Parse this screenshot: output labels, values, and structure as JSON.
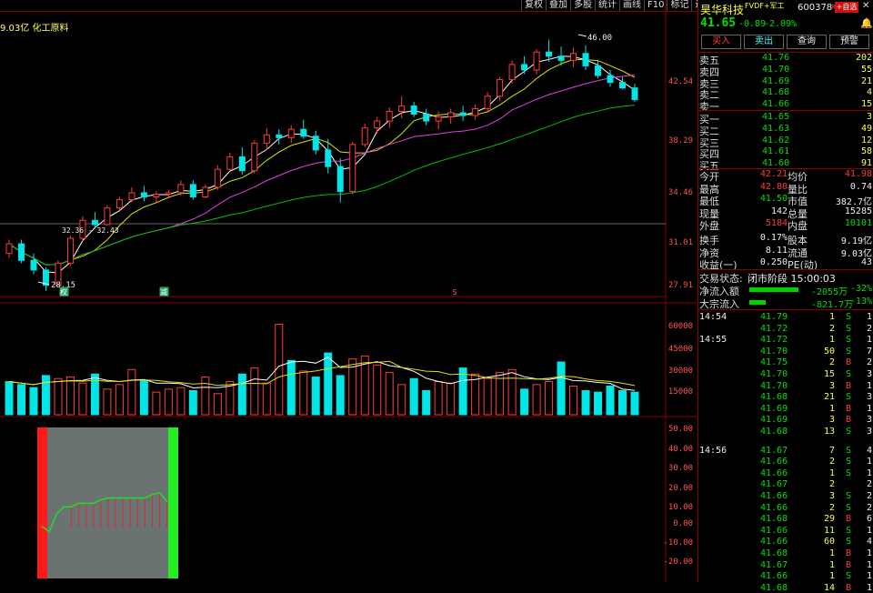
{
  "toolbar": [
    "复权",
    "叠加",
    "多股",
    "统计",
    "画线",
    "F10",
    "标记",
    "返回"
  ],
  "main_info": {
    "value": "9.03亿",
    "sector": "化工原料"
  },
  "price_axis": [
    "42.54",
    "38.29",
    "34.46",
    "31.01",
    "27.91"
  ],
  "price_marks": {
    "high": "46.00",
    "low": "28.15",
    "range": "32.36 - 32.43"
  },
  "event_labels": [
    "权",
    "减",
    "S"
  ],
  "volume_axis": [
    "60000",
    "45000",
    "30000",
    "15000"
  ],
  "indicator_axis": [
    "50.00",
    "40.00",
    "30.00",
    "20.00",
    "10.00",
    "0.00",
    "-10.00",
    "-20.00"
  ],
  "stock": {
    "name": "昊华科技",
    "tags": "FVDF+军工",
    "code": "600378",
    "flag": "R",
    "price": "41.65",
    "change": "-0.89",
    "pct": "-2.09%",
    "add_btn": "+自选"
  },
  "actions": [
    "买入",
    "卖出",
    "查询",
    "预警"
  ],
  "order_book": {
    "asks": [
      {
        "label": "卖五",
        "price": "41.76",
        "vol": "202"
      },
      {
        "label": "卖四",
        "price": "41.70",
        "vol": "55"
      },
      {
        "label": "卖三",
        "price": "41.69",
        "vol": "21"
      },
      {
        "label": "卖二",
        "price": "41.68",
        "vol": "4"
      },
      {
        "label": "卖一",
        "price": "41.66",
        "vol": "15"
      }
    ],
    "bids": [
      {
        "label": "买一",
        "price": "41.65",
        "vol": "3"
      },
      {
        "label": "买二",
        "price": "41.63",
        "vol": "49"
      },
      {
        "label": "买三",
        "price": "41.62",
        "vol": "12"
      },
      {
        "label": "买四",
        "price": "41.61",
        "vol": "58"
      },
      {
        "label": "买五",
        "price": "41.60",
        "vol": "91"
      }
    ]
  },
  "stats": [
    {
      "l1": "今开",
      "v1": "42.21",
      "c1": "red",
      "l2": "均价",
      "v2": "41.98",
      "c2": "red"
    },
    {
      "l1": "最高",
      "v1": "42.80",
      "c1": "red",
      "l2": "量比",
      "v2": "0.74",
      "c2": "white"
    },
    {
      "l1": "最低",
      "v1": "41.50",
      "c1": "green",
      "l2": "市值",
      "v2": "382.7亿",
      "c2": "white"
    },
    {
      "l1": "现量",
      "v1": "142",
      "c1": "white",
      "l2": "总量",
      "v2": "15285",
      "c2": "white"
    },
    {
      "l1": "外盘",
      "v1": "5184",
      "c1": "red",
      "l2": "内盘",
      "v2": "10101",
      "c2": "green"
    },
    {
      "l1": "换手",
      "v1": "0.17%",
      "c1": "white",
      "l2": "股本",
      "v2": "9.19亿",
      "c2": "white"
    },
    {
      "l1": "净资",
      "v1": "8.11",
      "c1": "white",
      "l2": "流通",
      "v2": "9.03亿",
      "c2": "white"
    },
    {
      "l1": "收益(一)",
      "v1": "0.250",
      "c1": "white",
      "l2": "PE(动)",
      "v2": "43",
      "c2": "white"
    }
  ],
  "status": {
    "label": "交易状态:",
    "value": "闭市阶段 15:00:03"
  },
  "flows": [
    {
      "label": "净流入额",
      "value": "-2055万",
      "pct": "-32%",
      "fill": 0.9
    },
    {
      "label": "大宗流入",
      "value": "-821.7万",
      "pct": "-13%",
      "fill": 0.3
    }
  ],
  "ticks": [
    {
      "time": "14:54",
      "price": "41.79",
      "vol": "1",
      "side": "S",
      "n": "1"
    },
    {
      "time": "",
      "price": "41.72",
      "vol": "2",
      "side": "S",
      "n": "2"
    },
    {
      "time": "14:55",
      "price": "41.72",
      "vol": "1",
      "side": "S",
      "n": "1"
    },
    {
      "time": "",
      "price": "41.70",
      "vol": "50",
      "side": "S",
      "n": "7"
    },
    {
      "time": "",
      "price": "41.75",
      "vol": "2",
      "side": "B",
      "n": "2"
    },
    {
      "time": "",
      "price": "41.70",
      "vol": "15",
      "side": "S",
      "n": "3"
    },
    {
      "time": "",
      "price": "41.70",
      "vol": "3",
      "side": "B",
      "n": "1"
    },
    {
      "time": "",
      "price": "41.68",
      "vol": "21",
      "side": "S",
      "n": "3"
    },
    {
      "time": "",
      "price": "41.69",
      "vol": "1",
      "side": "B",
      "n": "1"
    },
    {
      "time": "",
      "price": "41.69",
      "vol": "3",
      "side": "B",
      "n": "3"
    },
    {
      "time": "",
      "price": "41.68",
      "vol": "13",
      "side": "S",
      "n": "3"
    },
    {
      "time": "14:56",
      "price": "41.67",
      "vol": "7",
      "side": "S",
      "n": "4"
    },
    {
      "time": "",
      "price": "41.66",
      "vol": "2",
      "side": "S",
      "n": "1"
    },
    {
      "time": "",
      "price": "41.66",
      "vol": "1",
      "side": "S",
      "n": "1"
    },
    {
      "time": "",
      "price": "41.67",
      "vol": "2",
      "side": "",
      "n": "2"
    },
    {
      "time": "",
      "price": "41.66",
      "vol": "3",
      "side": "S",
      "n": "2"
    },
    {
      "time": "",
      "price": "41.66",
      "vol": "2",
      "side": "S",
      "n": "2"
    },
    {
      "time": "",
      "price": "41.68",
      "vol": "29",
      "side": "B",
      "n": "6"
    },
    {
      "time": "",
      "price": "41.66",
      "vol": "11",
      "side": "S",
      "n": "1"
    },
    {
      "time": "",
      "price": "41.66",
      "vol": "60",
      "side": "S",
      "n": "4"
    },
    {
      "time": "",
      "price": "41.68",
      "vol": "1",
      "side": "B",
      "n": "1"
    },
    {
      "time": "",
      "price": "41.67",
      "vol": "1",
      "side": "B",
      "n": "1"
    },
    {
      "time": "",
      "price": "41.66",
      "vol": "1",
      "side": "S",
      "n": "1"
    },
    {
      "time": "",
      "price": "41.68",
      "vol": "14",
      "side": "B",
      "n": "1"
    }
  ],
  "colors": {
    "up": "#ff3b3b",
    "down": "#00e5e5",
    "ma5": "#ffffff",
    "ma10": "#e0e000",
    "ma20": "#e040e0",
    "ma60": "#00c000",
    "frame": "#8b0000"
  },
  "chart_data": {
    "type": "candlestick",
    "y_range": [
      27.91,
      46.5
    ],
    "candles": [
      [
        30.5,
        31.5,
        30.2,
        31.2
      ],
      [
        31.2,
        31.5,
        29.8,
        30.0
      ],
      [
        30.0,
        30.5,
        29.0,
        29.3
      ],
      [
        29.3,
        29.5,
        27.8,
        28.2
      ],
      [
        28.2,
        30.0,
        28.15,
        29.8
      ],
      [
        29.8,
        31.8,
        29.6,
        31.6
      ],
      [
        31.6,
        33.2,
        31.4,
        32.9
      ],
      [
        32.9,
        33.5,
        32.3,
        32.6
      ],
      [
        32.6,
        34.0,
        32.5,
        33.8
      ],
      [
        33.8,
        34.6,
        33.6,
        34.4
      ],
      [
        34.4,
        35.3,
        34.2,
        34.9
      ],
      [
        34.9,
        35.4,
        34.3,
        34.6
      ],
      [
        34.6,
        35.0,
        34.2,
        34.8
      ],
      [
        34.8,
        35.1,
        34.5,
        34.9
      ],
      [
        34.9,
        35.8,
        34.7,
        35.5
      ],
      [
        35.5,
        35.8,
        34.4,
        34.6
      ],
      [
        34.6,
        35.5,
        34.5,
        35.3
      ],
      [
        35.3,
        36.9,
        35.1,
        36.6
      ],
      [
        36.6,
        37.8,
        36.5,
        37.5
      ],
      [
        37.5,
        38.2,
        36.2,
        36.5
      ],
      [
        36.5,
        38.7,
        36.3,
        38.5
      ],
      [
        38.5,
        39.6,
        38.0,
        39.1
      ],
      [
        39.1,
        39.5,
        38.4,
        38.9
      ],
      [
        38.9,
        39.8,
        38.5,
        39.5
      ],
      [
        39.5,
        40.2,
        38.8,
        39.0
      ],
      [
        39.0,
        39.4,
        37.7,
        38.0
      ],
      [
        38.0,
        38.8,
        36.3,
        36.8
      ],
      [
        36.8,
        37.4,
        34.2,
        35.0
      ],
      [
        35.0,
        38.6,
        34.8,
        38.4
      ],
      [
        38.4,
        39.9,
        38.2,
        39.6
      ],
      [
        39.6,
        40.4,
        39.2,
        40.1
      ],
      [
        40.1,
        41.1,
        39.6,
        40.8
      ],
      [
        40.8,
        41.9,
        40.3,
        41.2
      ],
      [
        41.2,
        41.5,
        40.4,
        40.6
      ],
      [
        40.6,
        41.0,
        39.8,
        40.1
      ],
      [
        40.1,
        40.8,
        39.5,
        40.4
      ],
      [
        40.4,
        41.0,
        39.9,
        40.7
      ],
      [
        40.7,
        41.2,
        40.1,
        40.5
      ],
      [
        40.5,
        41.3,
        40.2,
        41.0
      ],
      [
        41.0,
        42.2,
        40.8,
        41.9
      ],
      [
        41.9,
        43.3,
        41.6,
        43.1
      ],
      [
        43.1,
        44.5,
        42.8,
        44.2
      ],
      [
        44.2,
        44.8,
        43.5,
        43.8
      ],
      [
        43.8,
        45.3,
        43.5,
        45.1
      ],
      [
        45.1,
        46.0,
        44.4,
        44.8
      ],
      [
        44.8,
        45.5,
        44.1,
        44.5
      ],
      [
        44.5,
        45.4,
        44.0,
        45.0
      ],
      [
        45.0,
        45.6,
        43.8,
        44.1
      ],
      [
        44.1,
        44.5,
        43.2,
        43.4
      ],
      [
        43.4,
        43.8,
        42.6,
        42.9
      ],
      [
        42.9,
        43.3,
        42.4,
        42.5
      ],
      [
        42.5,
        42.8,
        41.5,
        41.65
      ]
    ],
    "volume": [
      22000,
      20000,
      18000,
      26000,
      24000,
      25000,
      21000,
      27000,
      17000,
      20000,
      30000,
      23000,
      15000,
      17000,
      18000,
      16000,
      25000,
      14000,
      22000,
      27000,
      31000,
      21000,
      60000,
      36000,
      29000,
      25000,
      41000,
      26000,
      37000,
      39000,
      33000,
      28000,
      20000,
      24000,
      16000,
      22000,
      21000,
      31000,
      27000,
      24000,
      28000,
      30000,
      17000,
      20000,
      22000,
      35000,
      19000,
      16000,
      15000,
      19000,
      16000,
      15000
    ],
    "volume_up": [
      false,
      false,
      false,
      false,
      true,
      true,
      true,
      false,
      true,
      true,
      true,
      false,
      true,
      true,
      true,
      false,
      true,
      true,
      true,
      false,
      true,
      true,
      true,
      false,
      true,
      false,
      false,
      false,
      true,
      true,
      true,
      true,
      true,
      false,
      false,
      true,
      true,
      false,
      true,
      true,
      true,
      true,
      false,
      true,
      true,
      false,
      true,
      false,
      false,
      false,
      false,
      false
    ],
    "indicator_range": [
      -25,
      55
    ],
    "indicator": [
      1,
      -2,
      8,
      12,
      12,
      14,
      14,
      14,
      16,
      17,
      17,
      17,
      17,
      17,
      17,
      19,
      20,
      15
    ]
  }
}
